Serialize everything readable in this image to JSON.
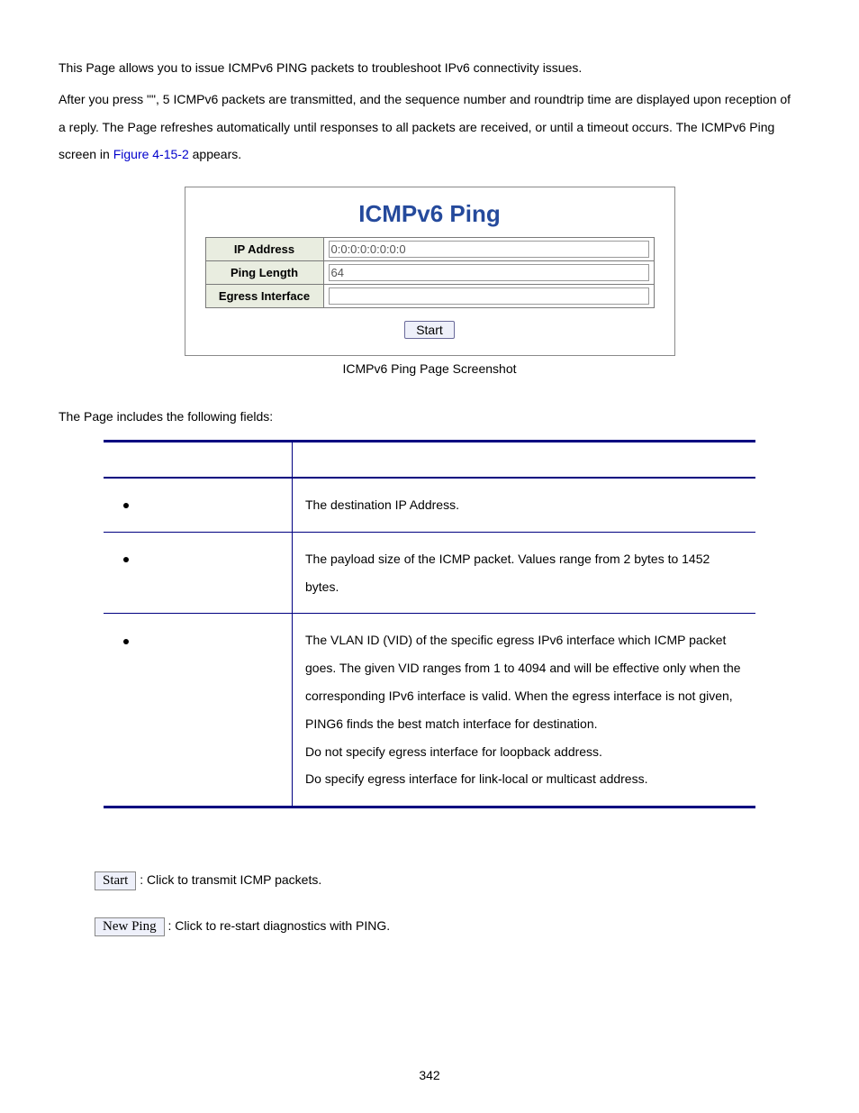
{
  "intro": {
    "line1": "This Page allows you to issue ICMPv6 PING packets to troubleshoot IPv6 connectivity issues.",
    "line2a": "After you press \"",
    "line2b": "\", 5 ICMPv6 packets are transmitted, and the sequence number and roundtrip time are displayed upon reception of a reply. The Page refreshes automatically until responses to all packets are received, or until a timeout occurs. The ICMPv6 Ping screen in ",
    "link": "Figure 4-15-2",
    "line2c": " appears."
  },
  "figure": {
    "title": "ICMPv6 Ping",
    "rows": {
      "ip_label": "IP Address",
      "ip_value": "0:0:0:0:0:0:0:0",
      "len_label": "Ping Length",
      "len_value": "64",
      "egress_label": "Egress Interface",
      "egress_value": ""
    },
    "button": "Start",
    "caption": "ICMPv6 Ping Page Screenshot"
  },
  "fields_intro": "The Page includes the following fields:",
  "fields_table": {
    "header_obj": "",
    "header_desc": "",
    "rows": [
      {
        "obj": "",
        "desc": "The destination IP Address."
      },
      {
        "obj": "",
        "desc": "The payload size of the ICMP packet. Values range from 2 bytes to 1452 bytes."
      },
      {
        "obj": "",
        "desc": "The VLAN ID (VID) of the specific egress IPv6 interface which ICMP packet goes. The given VID ranges from 1 to 4094 and will be effective only when the corresponding IPv6 interface is valid. When the egress interface is not given, PING6 finds the best match interface for destination.\nDo not specify egress interface for loopback address.\nDo specify egress interface for link-local or multicast address."
      }
    ]
  },
  "buttons": {
    "start_label": "Start",
    "start_desc": ": Click to transmit ICMP packets.",
    "newping_label": "New Ping",
    "newping_desc": ": Click to re-start diagnostics with PING."
  },
  "page_number": "342"
}
